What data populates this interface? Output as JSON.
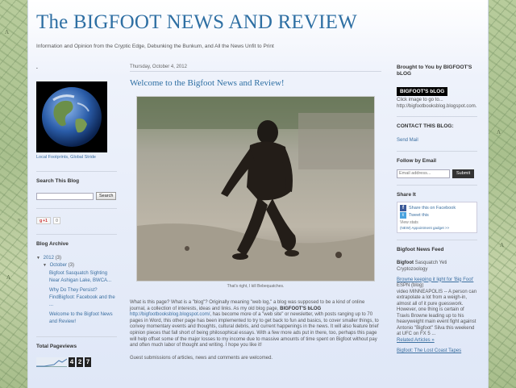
{
  "header": {
    "title": "The BIGFOOT NEWS AND REVIEW",
    "description": "Information and Opinion from the Cryptic Edge, Debunking the Bunkum, and All the News Unfit to Print"
  },
  "left": {
    "dot_title": ".",
    "globe_caption": "Local Footprints, Global Stride",
    "search_title": "Search This Blog",
    "search_placeholder": "",
    "search_button": "Search",
    "gplus_label": "+1",
    "gplus_count": "0",
    "archive_title": "Blog Archive",
    "archive": {
      "year": "2012",
      "year_count": "(3)",
      "month": "October",
      "month_count": "(3)",
      "posts": [
        "Bigfoot Sasquatch Sighting Near Ashigan Lake, BWCA...",
        "Why Do They Persist? FindBigfoot: Facebook and the ...",
        "Welcome to the Bigfoot News and Review!"
      ]
    },
    "pageviews_title": "Total Pageviews",
    "pageview_digits": [
      "4",
      "2",
      "7"
    ]
  },
  "main": {
    "date": "Thursday, October 4, 2012",
    "post_title": "Welcome to the Bigfoot News and Review!",
    "photo_caption": "That's right, I kill Bebequatches.",
    "para1_a": "What is this page? What is a \"blog\"? Originally meaning \"web log,\" a blog was supposed to be a kind of online journal, a collection of interests, ideas and links. As my old blog page,",
    "para1_bold": "BIGFOOT'S bLOG",
    "para1_link": "http://bigfootbooksblog.blogspot.com/",
    "para1_b": ", has become more of a \"web site\" or newsletter, with posts ranging up to 70 pages in Word, this other page has been implemented to try to get back to fun and basics, to cover smaller things, to convey momentary events and thoughts, cultural debris, and current happenings in the news. It will also feature brief opinion pieces that fall short of being philosophical essays. With a few more ads put in there, too, perhaps this page will help offset some of the major losses to my income due to massive amounts of time spent on Bigfoot without pay and often much labor of thought and writing. I hope you like it!",
    "para2": "Guest submissions of articles, news and comments are welcomed."
  },
  "right": {
    "brought_title": "Brought to You by BIGFOOT'S bLOG",
    "badge": "BIGFOOT'S bLOG",
    "click_text": "Click image to go to...",
    "click_url": "http://bigfootbooksblog.blogspot.com.",
    "contact_title": "CONTACT THIS BLOG:",
    "send_mail": "Send Mail",
    "follow_title": "Follow by Email",
    "email_placeholder": "Email address...",
    "submit": "Submit",
    "share_title": "Share It",
    "share_fb": "Share this on Facebook",
    "share_tw": "Tweet this",
    "view_stats": "View stats",
    "share_footlink": "(NEW) Appointment gadget >>",
    "feed_title": "Bigfoot News Feed",
    "feed_tags_bold": "Bigfoot",
    "feed_tags": "Sasquatch  Yeti Cryptozoology",
    "feed1_headline": "Browne keeping it light for 'Big Foot'",
    "feed1_source": "ESPN (blog)",
    "feed1_text": "video MINNEAPOLIS -- A person can extrapolate a lot from a weigh-in, almost all of it pure guesswork. However, one thing is certain of Travis Browne leading up to his heavyweight main event fight against Antonio \"Bigfoot\" Silva this weekend at UFC on FX 5 ...",
    "related": "Related Articles »",
    "feed2_headline": "Bigfoot: The Lost Coast Tapes"
  }
}
